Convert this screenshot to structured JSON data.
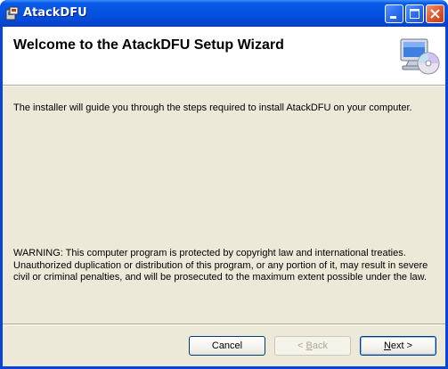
{
  "window": {
    "title": "AtackDFU",
    "controls": {
      "minimize": "minimize",
      "maximize": "maximize",
      "close": "close"
    }
  },
  "banner": {
    "title": "Welcome to the AtackDFU Setup Wizard",
    "icon": "computer-cd-icon"
  },
  "body": {
    "description": "The installer will guide you through the steps required to install AtackDFU on your computer.",
    "warning": "WARNING: This computer program is protected by copyright law and international treaties. Unauthorized duplication or distribution of this program, or any portion of it, may result in severe civil or criminal penalties, and will be prosecuted to the maximum extent possible under the law."
  },
  "buttons": {
    "cancel": "Cancel",
    "back_prefix": "< ",
    "back_accel": "B",
    "back_rest": "ack",
    "next_accel": "N",
    "next_rest": "ext >"
  },
  "colors": {
    "titlebar": "#0553e3",
    "dialog_bg": "#ece9d8",
    "banner_bg": "#ffffff"
  }
}
